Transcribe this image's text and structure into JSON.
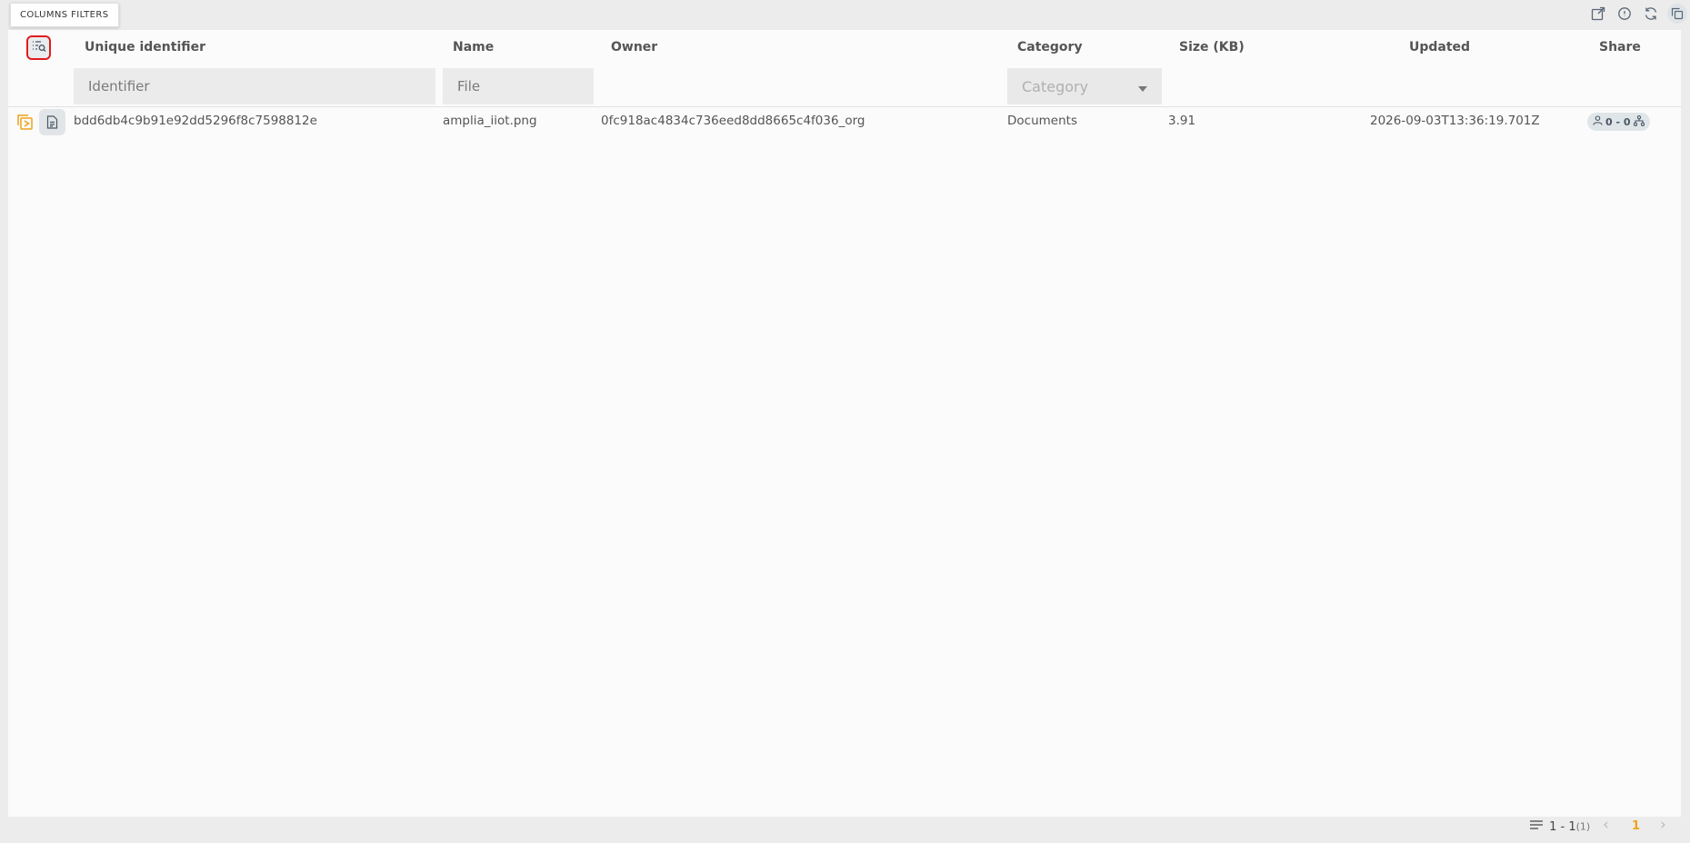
{
  "tooltip": {
    "text": "COLUMNS FILTERS"
  },
  "toolbar": {
    "icons": [
      "export-icon",
      "info-icon",
      "refresh-icon",
      "copy-icon"
    ]
  },
  "columns": {
    "identifier": "Unique identifier",
    "name": "Name",
    "owner": "Owner",
    "category": "Category",
    "size": "Size (KB)",
    "updated": "Updated",
    "share": "Share"
  },
  "filters": {
    "identifier_placeholder": "Identifier",
    "name_placeholder": "File",
    "category_placeholder": "Category"
  },
  "rows": [
    {
      "identifier": "bdd6db4c9b91e92dd5296f8c7598812e",
      "name": "amplia_iiot.png",
      "owner": "0fc918ac4834c736eed8dd8665c4f036_org",
      "category": "Documents",
      "size": "3.91",
      "updated": "2026-09-03T13:36:19.701Z",
      "share": "0 - 0"
    }
  ],
  "pagination": {
    "range": "1 - 1",
    "total": "(1)",
    "current_page": "1",
    "prev": "‹",
    "next": "›"
  },
  "colors": {
    "accent_orange": "#f0a21a",
    "highlight_red": "#e21c1c"
  }
}
